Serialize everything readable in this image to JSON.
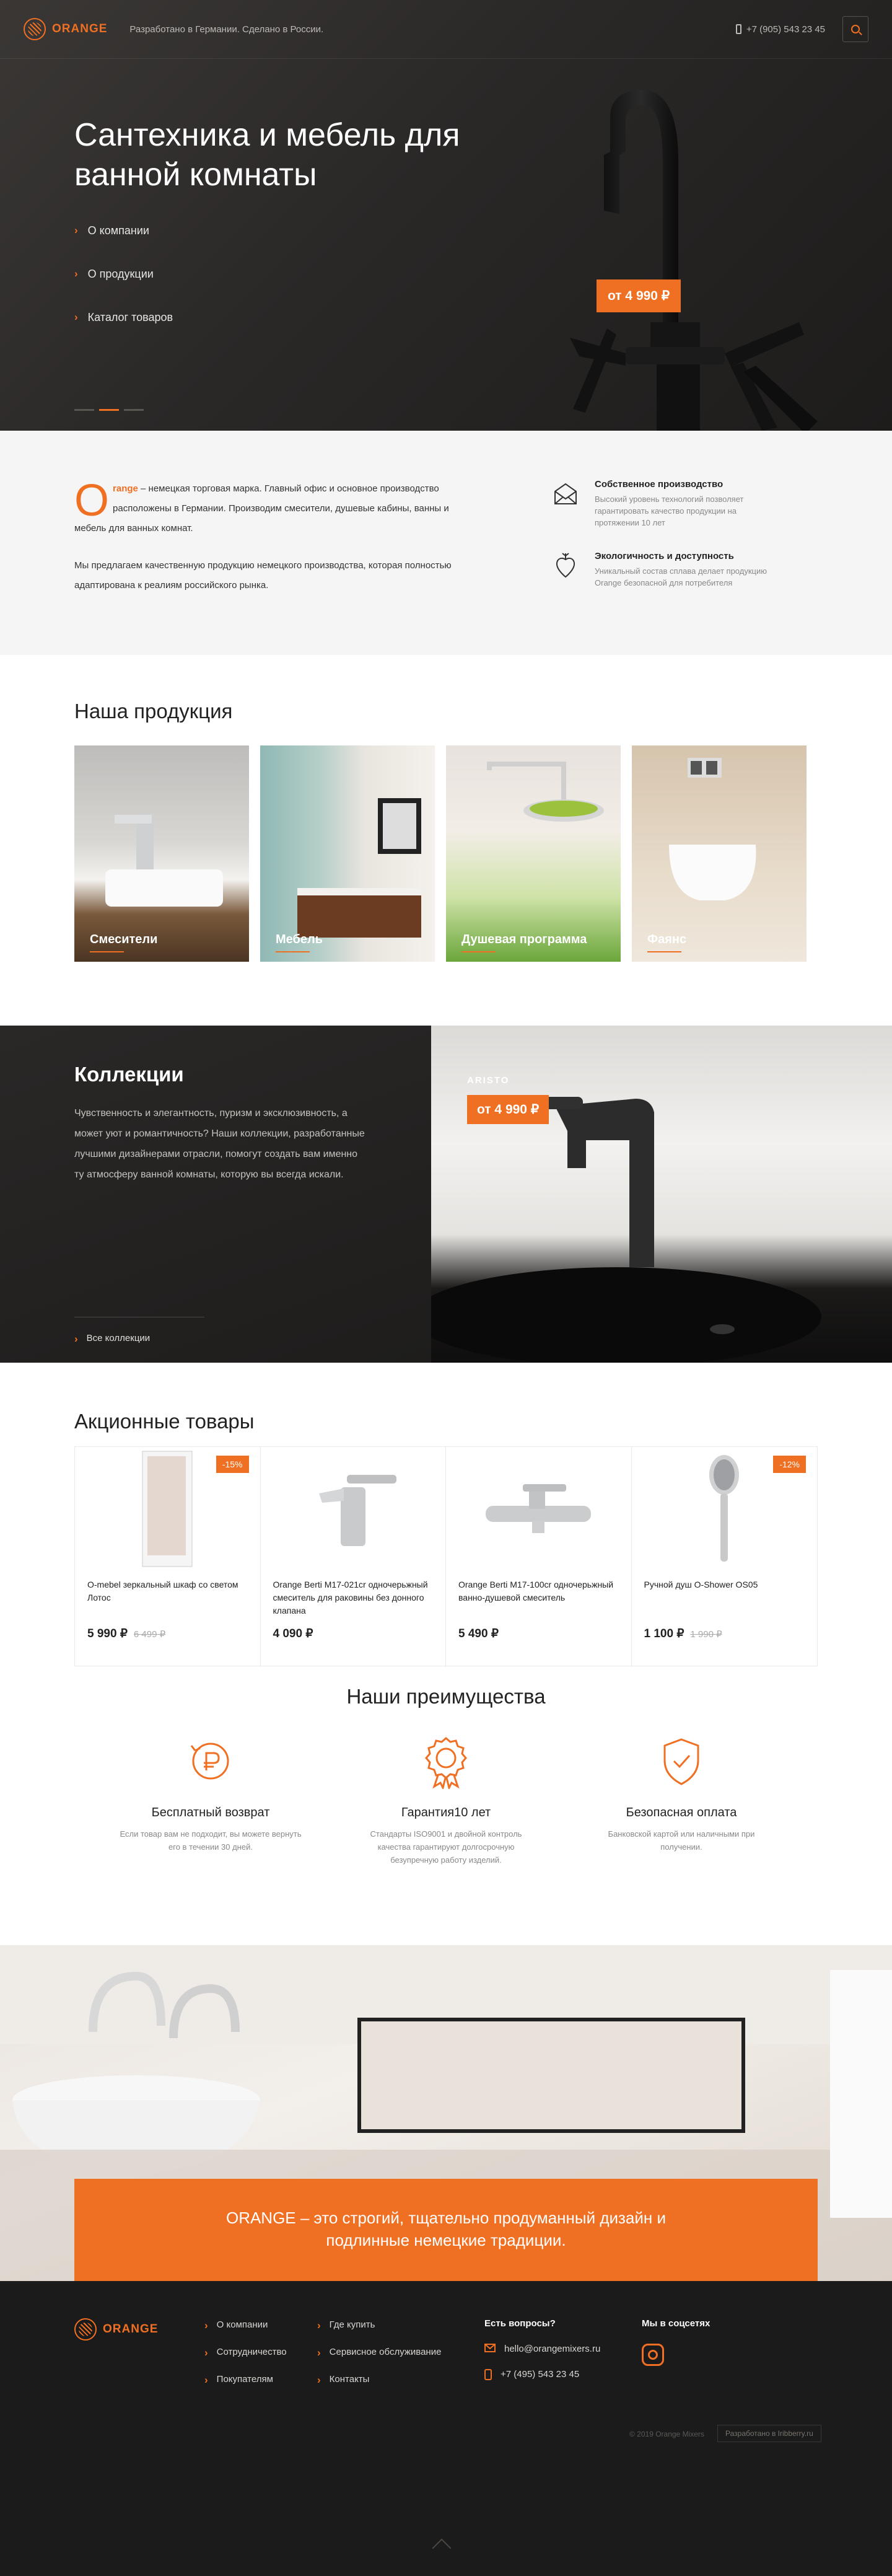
{
  "header": {
    "logo": "ORANGE",
    "tagline": "Разработано в Германии. Сделано в России.",
    "phone": "+7 (905) 543 23 45"
  },
  "hero": {
    "title": "Сантехника и мебель для ванной комнаты",
    "nav": [
      "О компании",
      "О продукции",
      "Каталог товаров"
    ],
    "price": "от 4 990 ₽",
    "slides_total": 3,
    "slide_active": 2
  },
  "about": {
    "dropcap": "O",
    "lead": "range",
    "paragraph1": " – немецкая торговая марка. Главный офис и основное производство расположены в Германии. Производим смесители, душевые кабины, ванны и мебель для ванных комнат.",
    "paragraph2": "Мы предлагаем качественную продукцию немецкого производства, которая полностью адаптирована к реалиям российского рынка.",
    "features": [
      {
        "icon": "production-icon",
        "title": "Собственное производство",
        "text": "Высокий уровень технологий позволяет гарантировать качество продукции на протяжении 10 лет"
      },
      {
        "icon": "eco-icon",
        "title": "Экологичность и доступность",
        "text": "Уникальный состав сплава делает продукцию Orange безопасной для потребителя"
      }
    ]
  },
  "products": {
    "title": "Наша продукция",
    "categories": [
      "Смесители",
      "Мебель",
      "Душевая программа",
      "Фаянс"
    ]
  },
  "collections": {
    "title": "Коллекции",
    "text": "Чувственность и элегантность, пуризм и эксклюзивность, а может уют и романтичность? Наши коллекции, разработанные лучшими дизайнерами отрасли, помогут создать вам именно ту атмосферу ванной комнаты, которую вы всегда искали.",
    "all_link": "Все коллекции",
    "featured_name": "ARISTO",
    "featured_price": "от 4 990 ₽"
  },
  "promo": {
    "title": "Акционные товары",
    "items": [
      {
        "name": "O-mebel зеркальный шкаф со светом Лотос",
        "price": "5 990 ₽",
        "old_price": "6 499 ₽",
        "discount": "-15%"
      },
      {
        "name": "Orange Berti M17-021cr одночерьжный смеситель для раковины без донного клапана",
        "price": "4 090 ₽",
        "old_price": "",
        "discount": ""
      },
      {
        "name": "Orange Berti M17-100cr одночерьжный ванно-душевой смеситель",
        "price": "5 490 ₽",
        "old_price": "",
        "discount": ""
      },
      {
        "name": "Ручной душ O-Shower OS05",
        "price": "1 100 ₽",
        "old_price": "1 990 ₽",
        "discount": "-12%"
      }
    ]
  },
  "advantages": {
    "title": "Наши преимущества",
    "items": [
      {
        "icon": "ruble-return-icon",
        "title": "Бесплатный возврат",
        "text": "Если товар вам не подходит, вы можете вернуть его в течении 30 дней."
      },
      {
        "icon": "award-icon",
        "title": "Гарантия10 лет",
        "text": "Стандарты ISO9001 и двойной контроль качества гарантируют долгосрочную безупречную работу изделий."
      },
      {
        "icon": "shield-check-icon",
        "title": "Безопасная оплата",
        "text": "Банковской картой или наличными при получении."
      }
    ]
  },
  "banner": {
    "text_line1": "ORANGE – это строгий, тщательно продуманный дизайн и",
    "text_line2": "подлинные немецкие традиции."
  },
  "footer": {
    "logo": "ORANGE",
    "col1": [
      "О компании",
      "Сотрудничество",
      "Покупателям"
    ],
    "col2": [
      "Где купить",
      "Сервисное обслуживание",
      "Контакты"
    ],
    "contacts_title": "Есть вопросы?",
    "email": "hello@orangemixers.ru",
    "phone": "+7 (495) 543 23 45",
    "social_title": "Мы в соцсетях",
    "copyright": "© 2019 Orange Mixers",
    "developer": "Разработано в Iribberry.ru"
  },
  "colors": {
    "accent": "#f07023",
    "dark": "#1c1b1b"
  }
}
